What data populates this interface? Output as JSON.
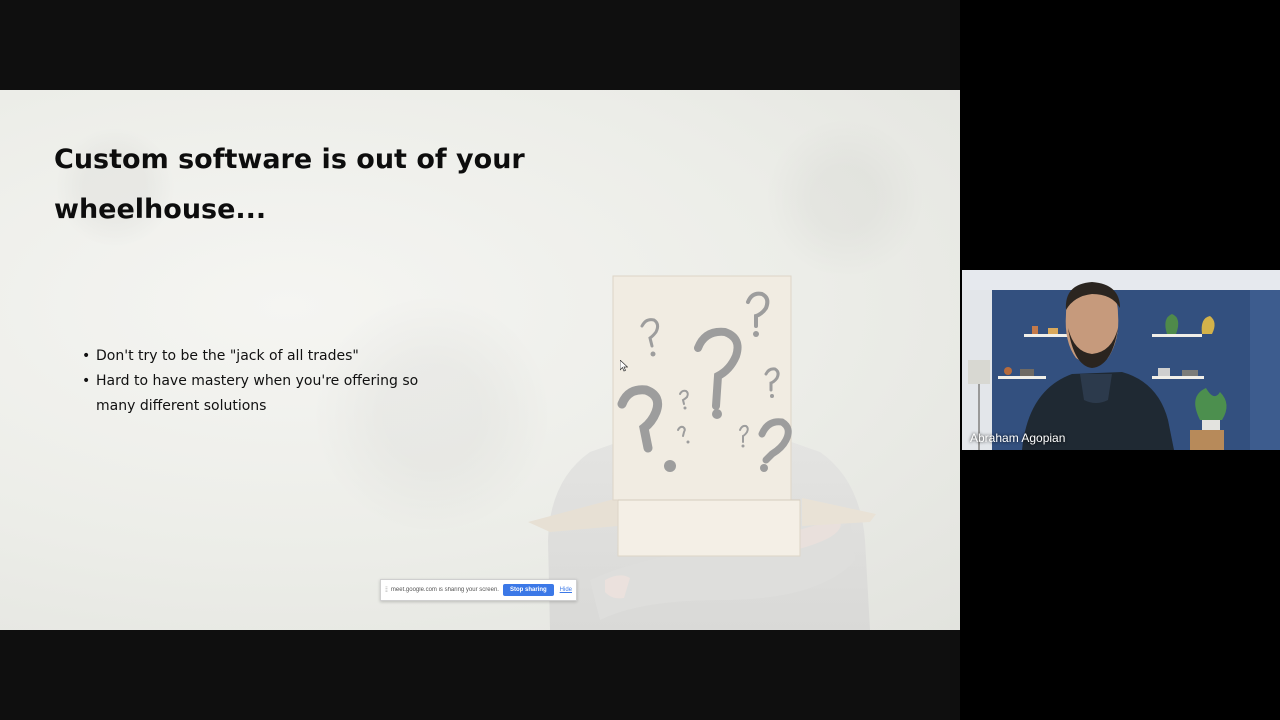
{
  "slide": {
    "title": "Custom software is out of your wheelhouse...",
    "bullets": [
      "Don't try to be the \"jack of all trades\"",
      "Hard to have mastery when you're offering so many different solutions"
    ],
    "illustration": "person-with-cardboard-box-head-question-marks"
  },
  "share_bar": {
    "message": "meet.google.com is sharing your screen.",
    "stop_label": "Stop sharing",
    "hide_label": "Hide",
    "stop_color": "#3b78e7"
  },
  "participant": {
    "name": "Abraham Agopian"
  },
  "colors": {
    "background": "#000000",
    "slide_background": "#ecede8",
    "wall_blue": "#2f4a7a"
  }
}
